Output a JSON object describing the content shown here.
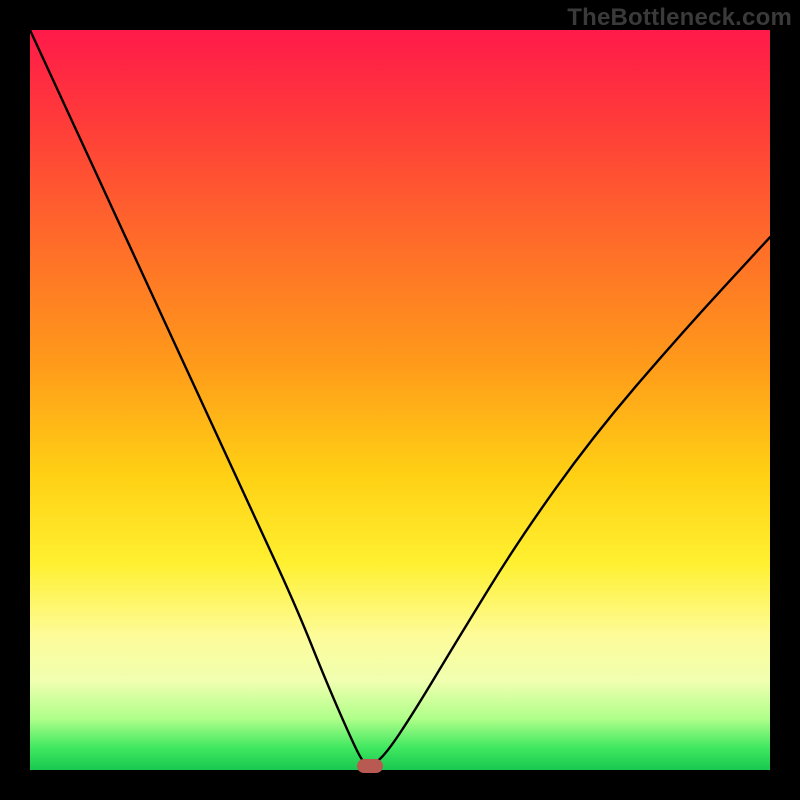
{
  "watermark": "TheBottleneck.com",
  "chart_data": {
    "type": "line",
    "title": "",
    "xlabel": "",
    "ylabel": "",
    "xlim": [
      0,
      100
    ],
    "ylim": [
      0,
      100
    ],
    "grid": false,
    "series": [
      {
        "name": "bottleneck-curve",
        "x": [
          0,
          6,
          12,
          18,
          24,
          30,
          36,
          40,
          43.5,
          45,
          46,
          48,
          52,
          58,
          66,
          76,
          88,
          100
        ],
        "y": [
          100,
          87,
          74,
          61,
          48,
          35,
          22,
          12,
          4,
          1,
          0.5,
          2,
          8,
          18,
          31,
          45,
          59,
          72
        ],
        "color": "#000000"
      }
    ],
    "marker": {
      "x": 46,
      "y": 0.5,
      "color": "#b85a52"
    },
    "gradient_stops": [
      {
        "pos": 0,
        "color": "#ff1a4a"
      },
      {
        "pos": 12,
        "color": "#ff3a3a"
      },
      {
        "pos": 28,
        "color": "#ff6a2a"
      },
      {
        "pos": 45,
        "color": "#ff9a1a"
      },
      {
        "pos": 60,
        "color": "#ffd014"
      },
      {
        "pos": 72,
        "color": "#fff030"
      },
      {
        "pos": 82,
        "color": "#fdfc9a"
      },
      {
        "pos": 88,
        "color": "#f0ffb0"
      },
      {
        "pos": 93,
        "color": "#b0ff8a"
      },
      {
        "pos": 97,
        "color": "#40e860"
      },
      {
        "pos": 100,
        "color": "#18c850"
      }
    ]
  }
}
